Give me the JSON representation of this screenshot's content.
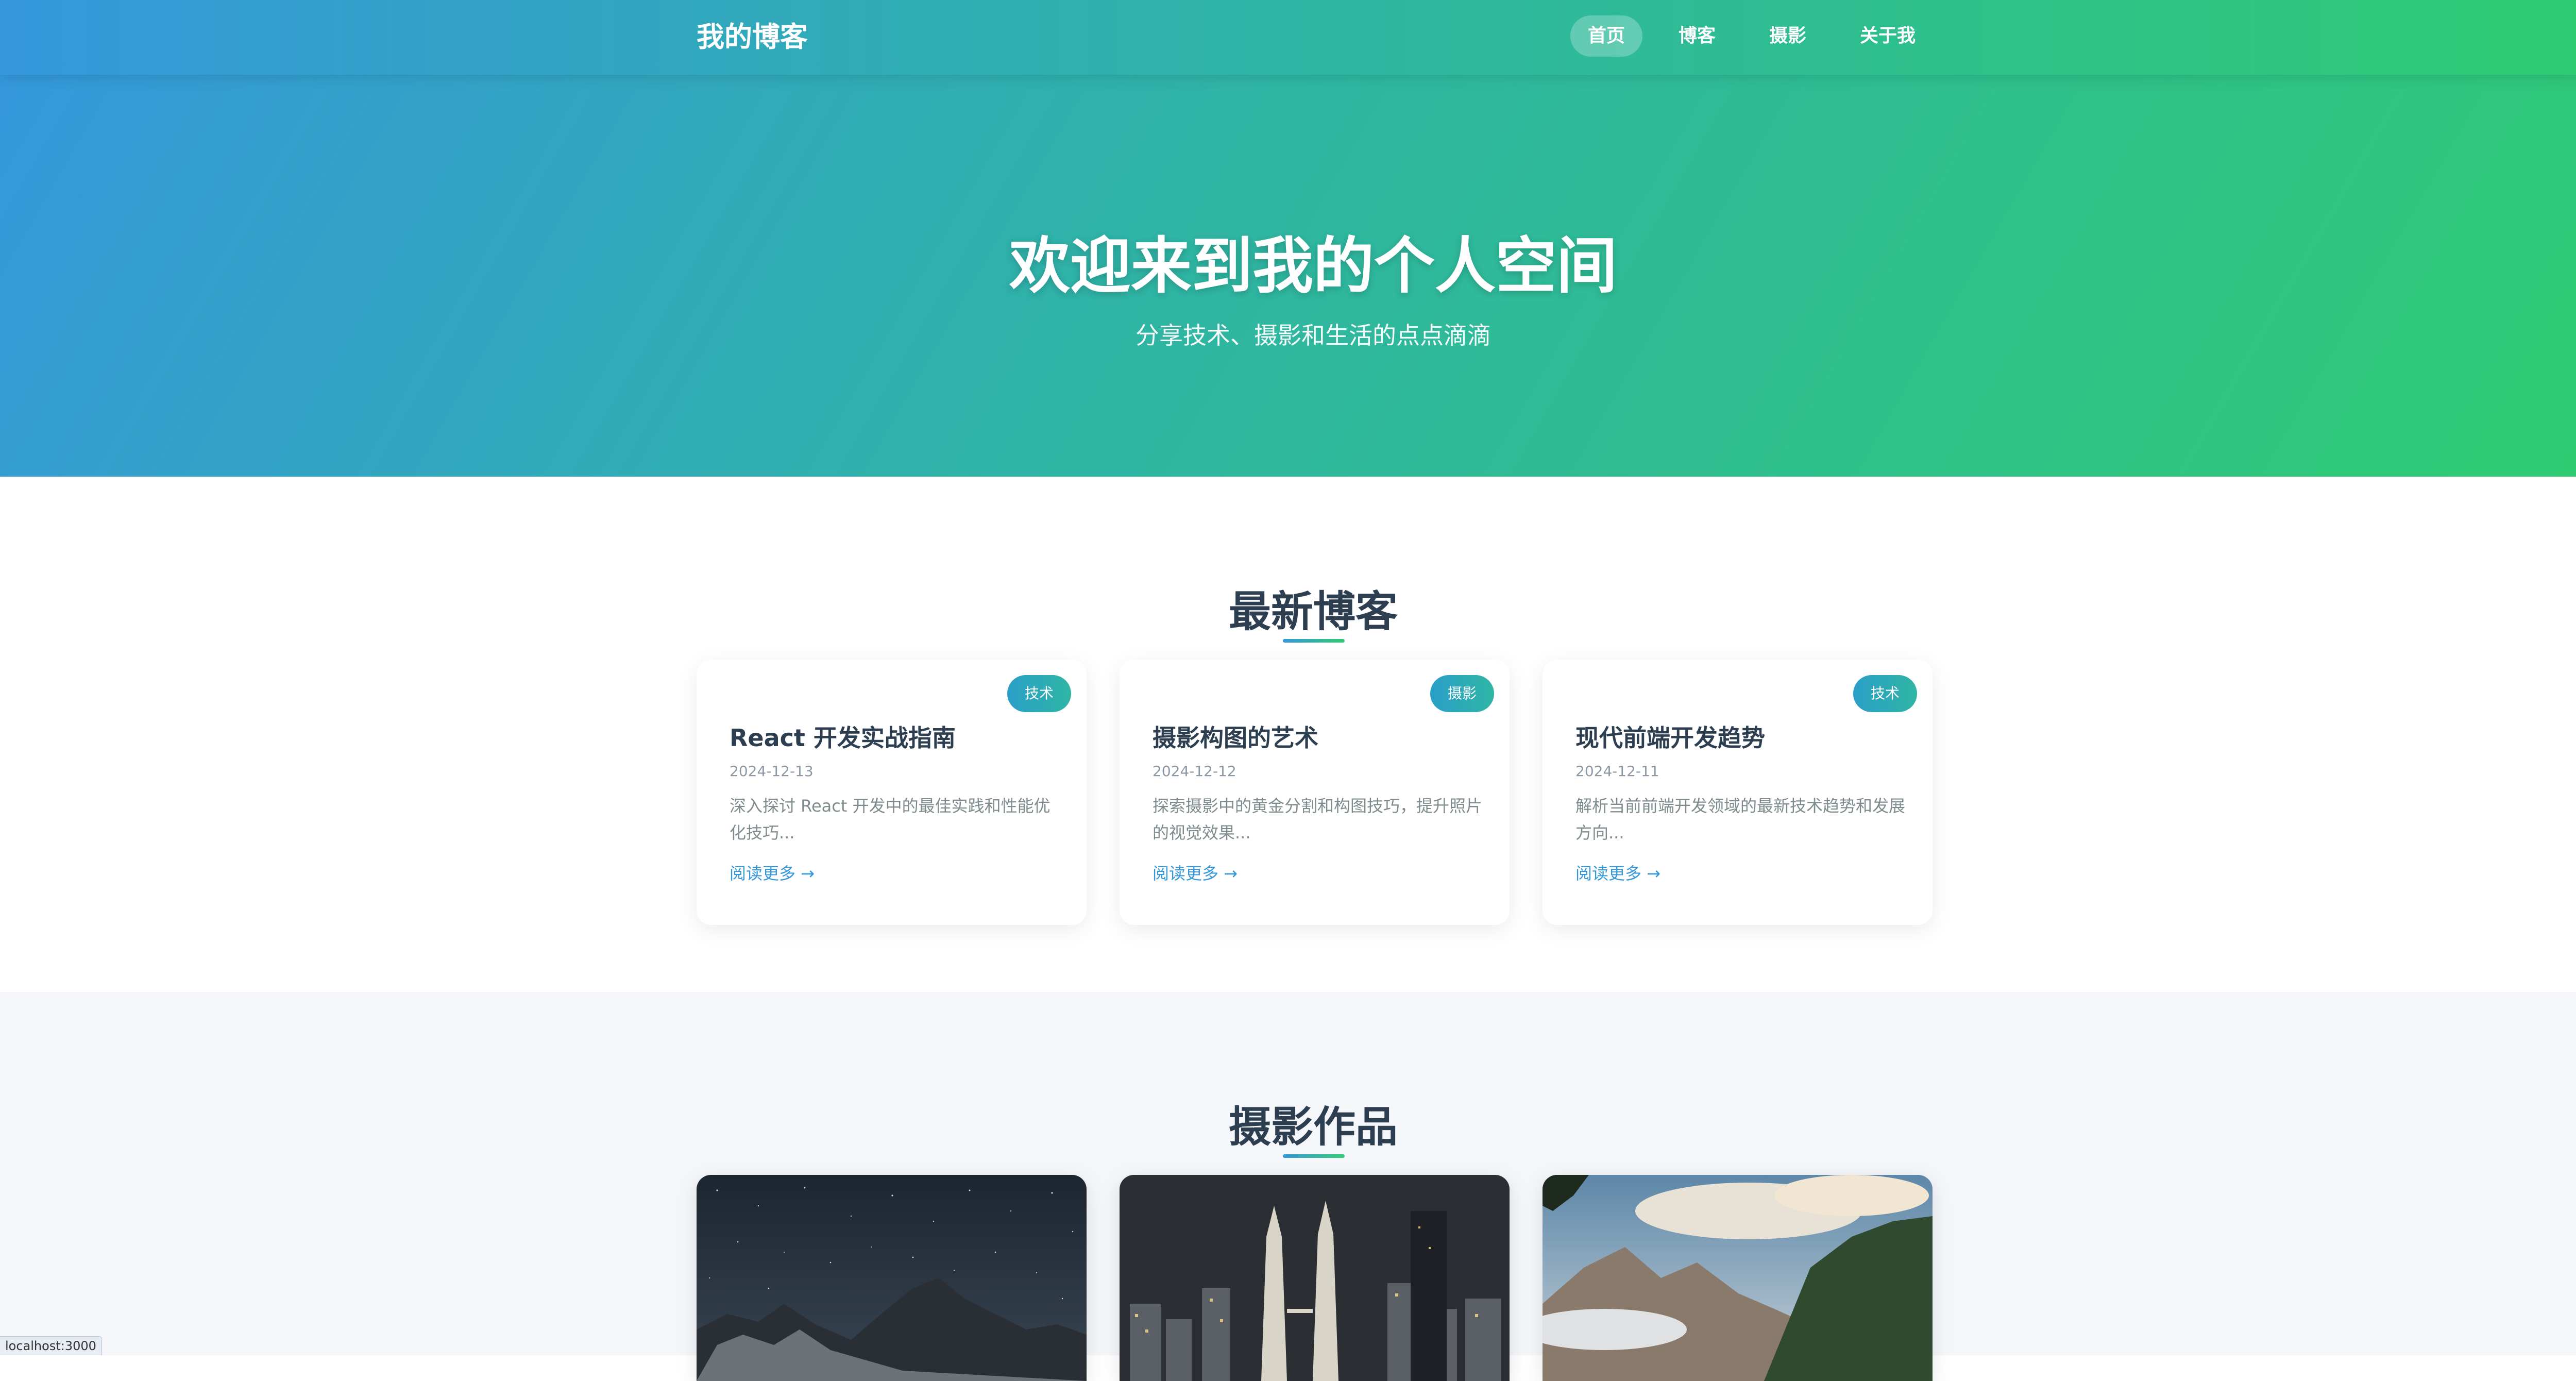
{
  "site": {
    "logo": "我的博客"
  },
  "nav": {
    "items": [
      {
        "label": "首页",
        "active": true
      },
      {
        "label": "博客",
        "active": false
      },
      {
        "label": "摄影",
        "active": false
      },
      {
        "label": "关于我",
        "active": false
      }
    ]
  },
  "hero": {
    "title": "欢迎来到我的个人空间",
    "subtitle": "分享技术、摄影和生活的点点滴滴"
  },
  "blog": {
    "section_title": "最新博客",
    "posts": [
      {
        "tag": "技术",
        "title": "React 开发实战指南",
        "date": "2024-12-13",
        "excerpt": "深入探讨 React 开发中的最佳实践和性能优化技巧...",
        "link": "阅读更多 →"
      },
      {
        "tag": "摄影",
        "title": "摄影构图的艺术",
        "date": "2024-12-12",
        "excerpt": "探索摄影中的黄金分割和构图技巧，提升照片的视觉效果...",
        "link": "阅读更多 →"
      },
      {
        "tag": "技术",
        "title": "现代前端开发趋势",
        "date": "2024-12-11",
        "excerpt": "解析当前前端开发领域的最新技术趋势和发展方向...",
        "link": "阅读更多 →"
      }
    ]
  },
  "photography": {
    "section_title": "摄影作品",
    "photos": [
      {
        "subject": "starry-mountain-night"
      },
      {
        "subject": "city-skyline-night"
      },
      {
        "subject": "mountain-clouds-forest"
      }
    ]
  },
  "status_bar": {
    "url": "localhost:3000"
  },
  "colors": {
    "gradient_start": "#3498db",
    "gradient_end": "#2ecc71",
    "link": "#3498db",
    "heading": "#2c3e50"
  }
}
